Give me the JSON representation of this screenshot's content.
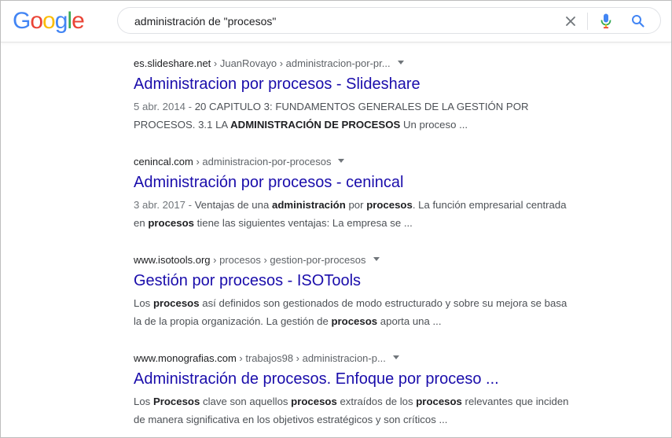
{
  "logo": {
    "letters": [
      {
        "ch": "G",
        "color": "#4285F4"
      },
      {
        "ch": "o",
        "color": "#EA4335"
      },
      {
        "ch": "o",
        "color": "#FBBC05"
      },
      {
        "ch": "g",
        "color": "#4285F4"
      },
      {
        "ch": "l",
        "color": "#34A853"
      },
      {
        "ch": "e",
        "color": "#EA4335"
      }
    ]
  },
  "search": {
    "query": "administración de \"procesos\"",
    "clear_icon": "close-icon",
    "voice_icon": "microphone-icon",
    "search_icon": "search-icon"
  },
  "colors": {
    "link": "#1a0dab",
    "snippet": "#4d5156",
    "url": "#202124"
  },
  "results": [
    {
      "domain": "es.slideshare.net",
      "path": " › JuanRovayo › administracion-por-pr...",
      "title": "Administracion por procesos - Slideshare",
      "snippet_line1": [
        {
          "t": "5 abr. 2014 - ",
          "d": true
        },
        {
          "t": "20 CAPITULO 3: FUNDAMENTOS GENERALES DE LA GESTIÓN POR"
        }
      ],
      "snippet_line2": [
        {
          "t": "PROCESOS. 3.1 LA "
        },
        {
          "t": "ADMINISTRACIÓN DE PROCESOS",
          "b": true
        },
        {
          "t": " Un proceso ..."
        }
      ]
    },
    {
      "domain": "cenincal.com",
      "path": " › administracion-por-procesos",
      "title": "Administración por procesos - cenincal",
      "snippet_line1": [
        {
          "t": "3 abr. 2017 - ",
          "d": true
        },
        {
          "t": "Ventajas de una "
        },
        {
          "t": "administración",
          "b": true
        },
        {
          "t": " por "
        },
        {
          "t": "procesos",
          "b": true
        },
        {
          "t": ". La función empresarial centrada"
        }
      ],
      "snippet_line2": [
        {
          "t": "en "
        },
        {
          "t": "procesos",
          "b": true
        },
        {
          "t": " tiene las siguientes ventajas: La empresa se ..."
        }
      ]
    },
    {
      "domain": "www.isotools.org",
      "path": " › procesos › gestion-por-procesos",
      "title": "Gestión por procesos - ISOTools",
      "snippet_line1": [
        {
          "t": "Los "
        },
        {
          "t": "procesos",
          "b": true
        },
        {
          "t": " así definidos son gestionados de modo estructurado y sobre su mejora se basa"
        }
      ],
      "snippet_line2": [
        {
          "t": "la de la propia organización. La gestión de "
        },
        {
          "t": "procesos",
          "b": true
        },
        {
          "t": " aporta una ..."
        }
      ]
    },
    {
      "domain": "www.monografias.com",
      "path": " › trabajos98 › administracion-p...",
      "title": "Administración de procesos. Enfoque por proceso ...",
      "snippet_line1": [
        {
          "t": "Los "
        },
        {
          "t": "Procesos",
          "b": true
        },
        {
          "t": " clave son aquellos "
        },
        {
          "t": "procesos",
          "b": true
        },
        {
          "t": " extraídos de los "
        },
        {
          "t": "procesos",
          "b": true
        },
        {
          "t": " relevantes que inciden"
        }
      ],
      "snippet_line2": [
        {
          "t": "de manera significativa en los objetivos estratégicos y son críticos ..."
        }
      ]
    }
  ]
}
